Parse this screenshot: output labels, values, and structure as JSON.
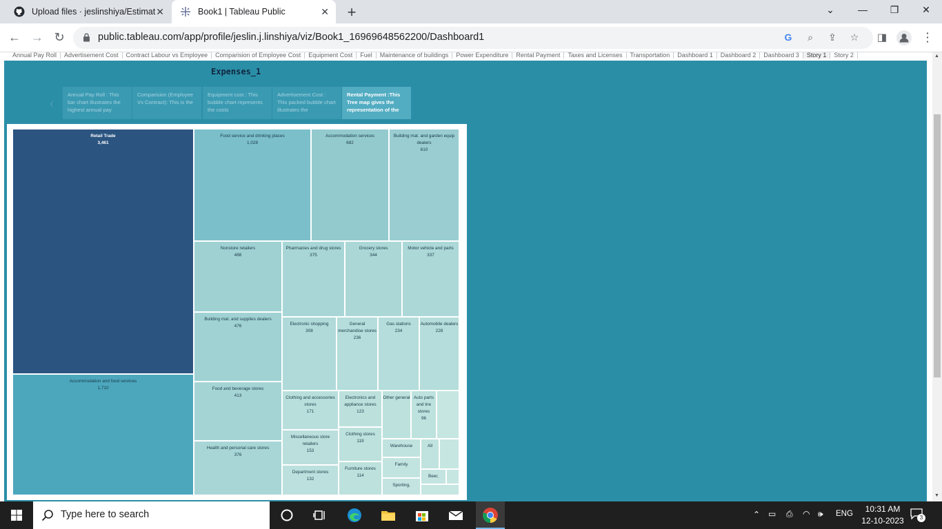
{
  "browser": {
    "tabs": [
      {
        "title": "Upload files · jeslinshiya/Estimat",
        "favicon": "github-icon",
        "active": false
      },
      {
        "title": "Book1 | Tableau Public",
        "favicon": "tableau-icon",
        "active": true
      }
    ],
    "new_tab_label": "+",
    "url": "public.tableau.com/app/profile/jeslin.j.linshiya/viz/Book1_16969648562200/Dashboard1"
  },
  "tableau": {
    "sheet_tabs": [
      "Annual Pay Roll",
      "Advertisement Cost",
      "Contract Labour vs Employee",
      "Comparision of Employee Cost",
      "Equipment Cost",
      "Fuel",
      "Maintenance of buildings",
      "Power Expenditure",
      "Rental Payment",
      "Taxes and Licenses",
      "Transportation",
      "Dashboard 1",
      "Dashboard 2",
      "Dashboard 3",
      "Story 1",
      "Story 2"
    ],
    "active_sheet_tab": "Story 1",
    "story_title": "Expenses_1",
    "story_points": [
      "Annual Pay Roll : This bar chart illustrates the highest annual pay",
      "Comparision (Employee Vs Contract): This is the",
      "Equipment cost : This bubble chart represents the costs",
      "Advertisement Cost : This packed bubble chart illustrates the",
      "Rental Payment :This Tree  map gives the representation of the"
    ],
    "active_story_point": 4
  },
  "chart_data": {
    "type": "treemap",
    "cells": [
      {
        "label": "Retail Trade",
        "value": "3,461",
        "color": "#2b5480"
      },
      {
        "label": "Accommodation and food services",
        "value": "1,710",
        "color": "#4ca7bd"
      },
      {
        "label": "Food service and drinking places",
        "value": "1,028",
        "color": "#7bbfcb"
      },
      {
        "label": "Accommodation services",
        "value": "682",
        "color": "#93cace"
      },
      {
        "label": "Building mat. and garden equip dealers",
        "value": "610",
        "color": "#99cdd1"
      },
      {
        "label": "Nonstore retailers",
        "value": "488",
        "color": "#9fd1d3"
      },
      {
        "label": "Building mat. and supplies dealers",
        "value": "476",
        "color": "#a0d2d4"
      },
      {
        "label": "Food and beverage stores",
        "value": "413",
        "color": "#a5d4d5"
      },
      {
        "label": "Pharmacies and drug stores",
        "value": "375",
        "color": "#a8d6d6"
      },
      {
        "label": "Health and personal care stores",
        "value": "376",
        "color": "#a8d6d6"
      },
      {
        "label": "Grocery stores",
        "value": "344",
        "color": "#abd8d7"
      },
      {
        "label": "Motor vehicle and parts",
        "value": "337",
        "color": "#acd8d8"
      },
      {
        "label": "Electronic shopping",
        "value": "308",
        "color": "#afdad9"
      },
      {
        "label": "General merchandise stores",
        "value": "236",
        "color": "#b4dddb"
      },
      {
        "label": "Gas stations",
        "value": "234",
        "color": "#b4dddb"
      },
      {
        "label": "Automobile dealers",
        "value": "228",
        "color": "#b5dddb"
      },
      {
        "label": "Clothing and accessories stores",
        "value": "171",
        "color": "#b9dfdc"
      },
      {
        "label": "Electronics and appliance stores",
        "value": "123",
        "color": "#bce1dd"
      },
      {
        "label": "Other general",
        "value": "",
        "color": "#bde1dd"
      },
      {
        "label": "Auto parts and tire stores",
        "value": "96",
        "color": "#bee2de"
      },
      {
        "label": "Miscellaneous store retailers",
        "value": "153",
        "color": "#badfdc"
      },
      {
        "label": "Clothing stores",
        "value": "119",
        "color": "#bde1dd"
      },
      {
        "label": "Department stores",
        "value": "132",
        "color": "#bce0dd"
      },
      {
        "label": "Furniture stores",
        "value": "114",
        "color": "#bde1dd"
      },
      {
        "label": "Warehouse",
        "value": "",
        "color": "#c0e3df"
      },
      {
        "label": "All",
        "value": "",
        "color": "#c0e3df"
      },
      {
        "label": "Family",
        "value": "",
        "color": "#c2e4e0"
      },
      {
        "label": "Beer,",
        "value": "",
        "color": "#c3e4e0"
      },
      {
        "label": "Sporting,",
        "value": "",
        "color": "#c3e4e0"
      }
    ]
  },
  "taskbar": {
    "search_placeholder": "Type here to search",
    "language": "ENG",
    "time": "10:31 AM",
    "date": "12-10-2023",
    "notification_count": "3"
  }
}
